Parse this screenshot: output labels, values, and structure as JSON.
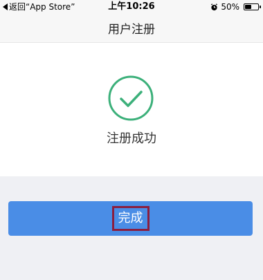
{
  "status_bar": {
    "back_label": "返回“App Store”",
    "time": "上午10:26",
    "battery_percent": "50%",
    "battery_level": 0.5
  },
  "nav": {
    "title": "用户注册"
  },
  "main": {
    "success_text": "注册成功",
    "success_icon": "check-circle-icon",
    "accent_color": "#3cb07a"
  },
  "actions": {
    "done_label": "完成",
    "button_color": "#4a8de6",
    "highlight_color": "#8b1e3f"
  }
}
